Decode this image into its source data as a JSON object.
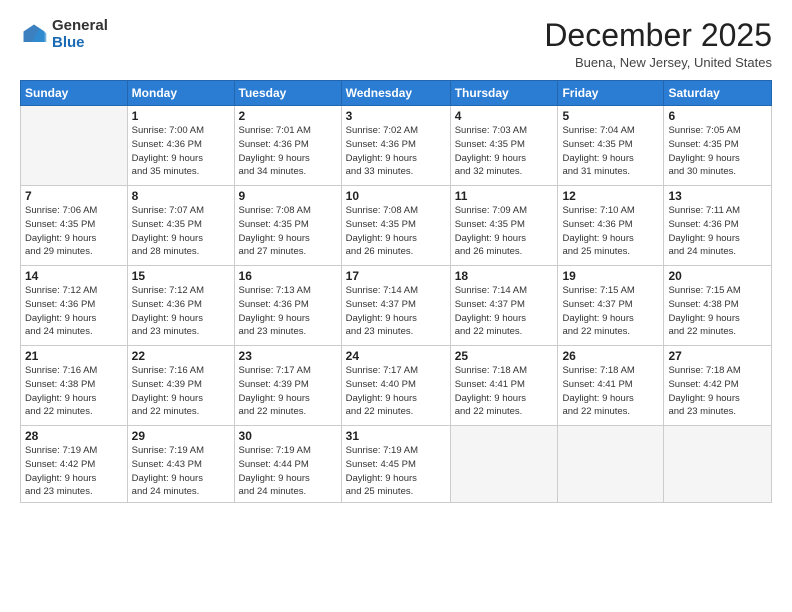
{
  "logo": {
    "general": "General",
    "blue": "Blue"
  },
  "title": "December 2025",
  "location": "Buena, New Jersey, United States",
  "days_of_week": [
    "Sunday",
    "Monday",
    "Tuesday",
    "Wednesday",
    "Thursday",
    "Friday",
    "Saturday"
  ],
  "weeks": [
    [
      {
        "day": "",
        "info": ""
      },
      {
        "day": "1",
        "info": "Sunrise: 7:00 AM\nSunset: 4:36 PM\nDaylight: 9 hours\nand 35 minutes."
      },
      {
        "day": "2",
        "info": "Sunrise: 7:01 AM\nSunset: 4:36 PM\nDaylight: 9 hours\nand 34 minutes."
      },
      {
        "day": "3",
        "info": "Sunrise: 7:02 AM\nSunset: 4:36 PM\nDaylight: 9 hours\nand 33 minutes."
      },
      {
        "day": "4",
        "info": "Sunrise: 7:03 AM\nSunset: 4:35 PM\nDaylight: 9 hours\nand 32 minutes."
      },
      {
        "day": "5",
        "info": "Sunrise: 7:04 AM\nSunset: 4:35 PM\nDaylight: 9 hours\nand 31 minutes."
      },
      {
        "day": "6",
        "info": "Sunrise: 7:05 AM\nSunset: 4:35 PM\nDaylight: 9 hours\nand 30 minutes."
      }
    ],
    [
      {
        "day": "7",
        "info": "Sunrise: 7:06 AM\nSunset: 4:35 PM\nDaylight: 9 hours\nand 29 minutes."
      },
      {
        "day": "8",
        "info": "Sunrise: 7:07 AM\nSunset: 4:35 PM\nDaylight: 9 hours\nand 28 minutes."
      },
      {
        "day": "9",
        "info": "Sunrise: 7:08 AM\nSunset: 4:35 PM\nDaylight: 9 hours\nand 27 minutes."
      },
      {
        "day": "10",
        "info": "Sunrise: 7:08 AM\nSunset: 4:35 PM\nDaylight: 9 hours\nand 26 minutes."
      },
      {
        "day": "11",
        "info": "Sunrise: 7:09 AM\nSunset: 4:35 PM\nDaylight: 9 hours\nand 26 minutes."
      },
      {
        "day": "12",
        "info": "Sunrise: 7:10 AM\nSunset: 4:36 PM\nDaylight: 9 hours\nand 25 minutes."
      },
      {
        "day": "13",
        "info": "Sunrise: 7:11 AM\nSunset: 4:36 PM\nDaylight: 9 hours\nand 24 minutes."
      }
    ],
    [
      {
        "day": "14",
        "info": "Sunrise: 7:12 AM\nSunset: 4:36 PM\nDaylight: 9 hours\nand 24 minutes."
      },
      {
        "day": "15",
        "info": "Sunrise: 7:12 AM\nSunset: 4:36 PM\nDaylight: 9 hours\nand 23 minutes."
      },
      {
        "day": "16",
        "info": "Sunrise: 7:13 AM\nSunset: 4:36 PM\nDaylight: 9 hours\nand 23 minutes."
      },
      {
        "day": "17",
        "info": "Sunrise: 7:14 AM\nSunset: 4:37 PM\nDaylight: 9 hours\nand 23 minutes."
      },
      {
        "day": "18",
        "info": "Sunrise: 7:14 AM\nSunset: 4:37 PM\nDaylight: 9 hours\nand 22 minutes."
      },
      {
        "day": "19",
        "info": "Sunrise: 7:15 AM\nSunset: 4:37 PM\nDaylight: 9 hours\nand 22 minutes."
      },
      {
        "day": "20",
        "info": "Sunrise: 7:15 AM\nSunset: 4:38 PM\nDaylight: 9 hours\nand 22 minutes."
      }
    ],
    [
      {
        "day": "21",
        "info": "Sunrise: 7:16 AM\nSunset: 4:38 PM\nDaylight: 9 hours\nand 22 minutes."
      },
      {
        "day": "22",
        "info": "Sunrise: 7:16 AM\nSunset: 4:39 PM\nDaylight: 9 hours\nand 22 minutes."
      },
      {
        "day": "23",
        "info": "Sunrise: 7:17 AM\nSunset: 4:39 PM\nDaylight: 9 hours\nand 22 minutes."
      },
      {
        "day": "24",
        "info": "Sunrise: 7:17 AM\nSunset: 4:40 PM\nDaylight: 9 hours\nand 22 minutes."
      },
      {
        "day": "25",
        "info": "Sunrise: 7:18 AM\nSunset: 4:41 PM\nDaylight: 9 hours\nand 22 minutes."
      },
      {
        "day": "26",
        "info": "Sunrise: 7:18 AM\nSunset: 4:41 PM\nDaylight: 9 hours\nand 22 minutes."
      },
      {
        "day": "27",
        "info": "Sunrise: 7:18 AM\nSunset: 4:42 PM\nDaylight: 9 hours\nand 23 minutes."
      }
    ],
    [
      {
        "day": "28",
        "info": "Sunrise: 7:19 AM\nSunset: 4:42 PM\nDaylight: 9 hours\nand 23 minutes."
      },
      {
        "day": "29",
        "info": "Sunrise: 7:19 AM\nSunset: 4:43 PM\nDaylight: 9 hours\nand 24 minutes."
      },
      {
        "day": "30",
        "info": "Sunrise: 7:19 AM\nSunset: 4:44 PM\nDaylight: 9 hours\nand 24 minutes."
      },
      {
        "day": "31",
        "info": "Sunrise: 7:19 AM\nSunset: 4:45 PM\nDaylight: 9 hours\nand 25 minutes."
      },
      {
        "day": "",
        "info": ""
      },
      {
        "day": "",
        "info": ""
      },
      {
        "day": "",
        "info": ""
      }
    ]
  ]
}
